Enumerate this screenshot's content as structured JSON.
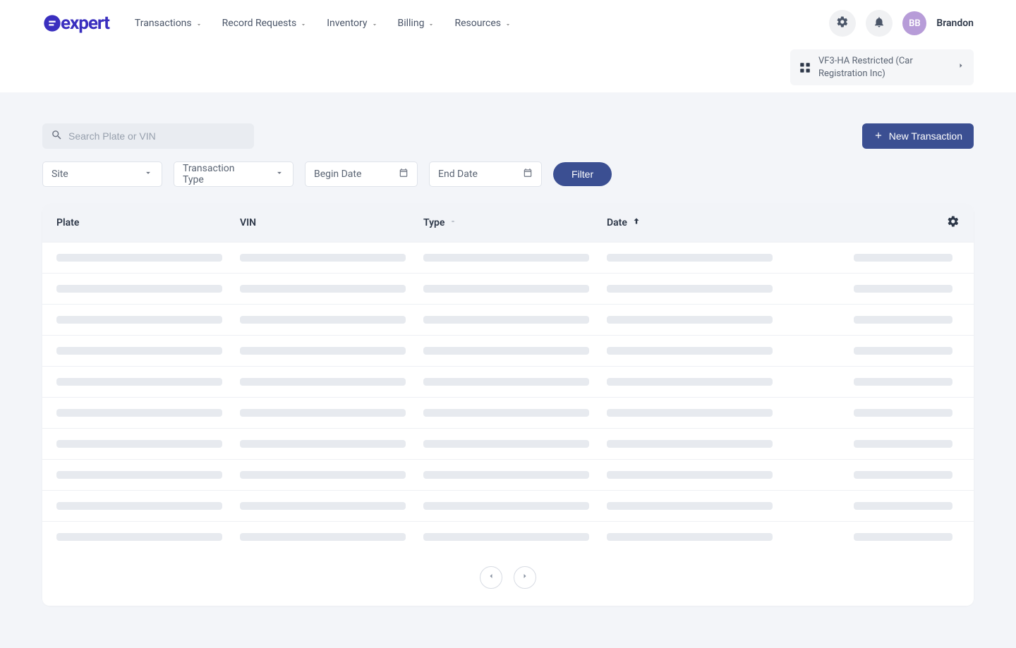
{
  "brand": "expert",
  "nav": {
    "transactions": "Transactions",
    "record_requests": "Record Requests",
    "inventory": "Inventory",
    "billing": "Billing",
    "resources": "Resources"
  },
  "user": {
    "initials": "BB",
    "name": "Brandon"
  },
  "context": {
    "label": "VF3-HA Restricted (Car Registration Inc)"
  },
  "search": {
    "placeholder": "Search Plate or VIN"
  },
  "buttons": {
    "new_transaction": "New Transaction",
    "filter": "Filter"
  },
  "filters": {
    "site": "Site",
    "transaction_type": "Transaction Type",
    "begin_date": "Begin Date",
    "end_date": "End Date"
  },
  "table": {
    "headers": {
      "plate": "Plate",
      "vin": "VIN",
      "type": "Type",
      "date": "Date"
    },
    "loading_rows": 10
  }
}
